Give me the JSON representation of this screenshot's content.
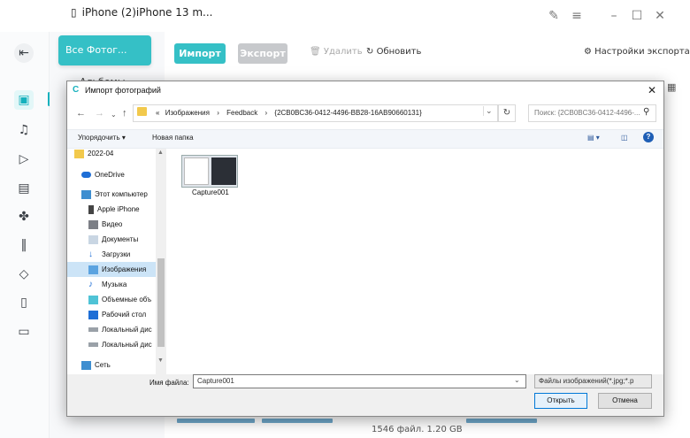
{
  "app": {
    "device_name": "iPhone (2)iPhone 13 m...",
    "all_photos": "Все Фотог...",
    "albums": "Альбомы",
    "toolbar": {
      "import": "Импорт",
      "export": "Экспорт",
      "delete": "Удалить",
      "refresh": "Обновить",
      "export_settings": "Настройки экспорта"
    },
    "status": "1546 файл. 1.20 GB",
    "accent": "#35c0c6"
  },
  "dialog": {
    "title": "Импорт фотографий",
    "address": {
      "sep1": "«",
      "crumbs": [
        "Изображения",
        "Feedback",
        "{2CB0BC36-0412-4496-BB28-16AB90660131}"
      ]
    },
    "search_placeholder": "Поиск: {2CB0BC36-0412-4496-...",
    "commands": {
      "organize": "Упорядочить ▾",
      "new_folder": "Новая папка"
    },
    "nav": [
      {
        "label": "2022-04",
        "icon": "folder-icon"
      },
      {
        "label": "OneDrive",
        "icon": "cloud-icon"
      },
      {
        "label": "Этот компьютер",
        "icon": "computer-icon"
      },
      {
        "label": "Apple iPhone",
        "icon": "phone-icon"
      },
      {
        "label": "Видео",
        "icon": "video-icon"
      },
      {
        "label": "Документы",
        "icon": "documents-icon"
      },
      {
        "label": "Загрузки",
        "icon": "downloads-icon"
      },
      {
        "label": "Изображения",
        "icon": "pictures-icon",
        "selected": true
      },
      {
        "label": "Музыка",
        "icon": "music-icon"
      },
      {
        "label": "Объемные объ",
        "icon": "3d-objects-icon"
      },
      {
        "label": "Рабочий стол",
        "icon": "desktop-icon"
      },
      {
        "label": "Локальный дис",
        "icon": "drive-icon"
      },
      {
        "label": "Локальный дис",
        "icon": "drive-icon"
      },
      {
        "label": "Сеть",
        "icon": "network-icon"
      }
    ],
    "file": {
      "name": "Capture001"
    },
    "filename_label": "Имя файла:",
    "filename_value": "Capture001",
    "filetype": "Файлы изображений(*.jpg;*.p",
    "open": "Открыть",
    "cancel": "Отмена"
  }
}
